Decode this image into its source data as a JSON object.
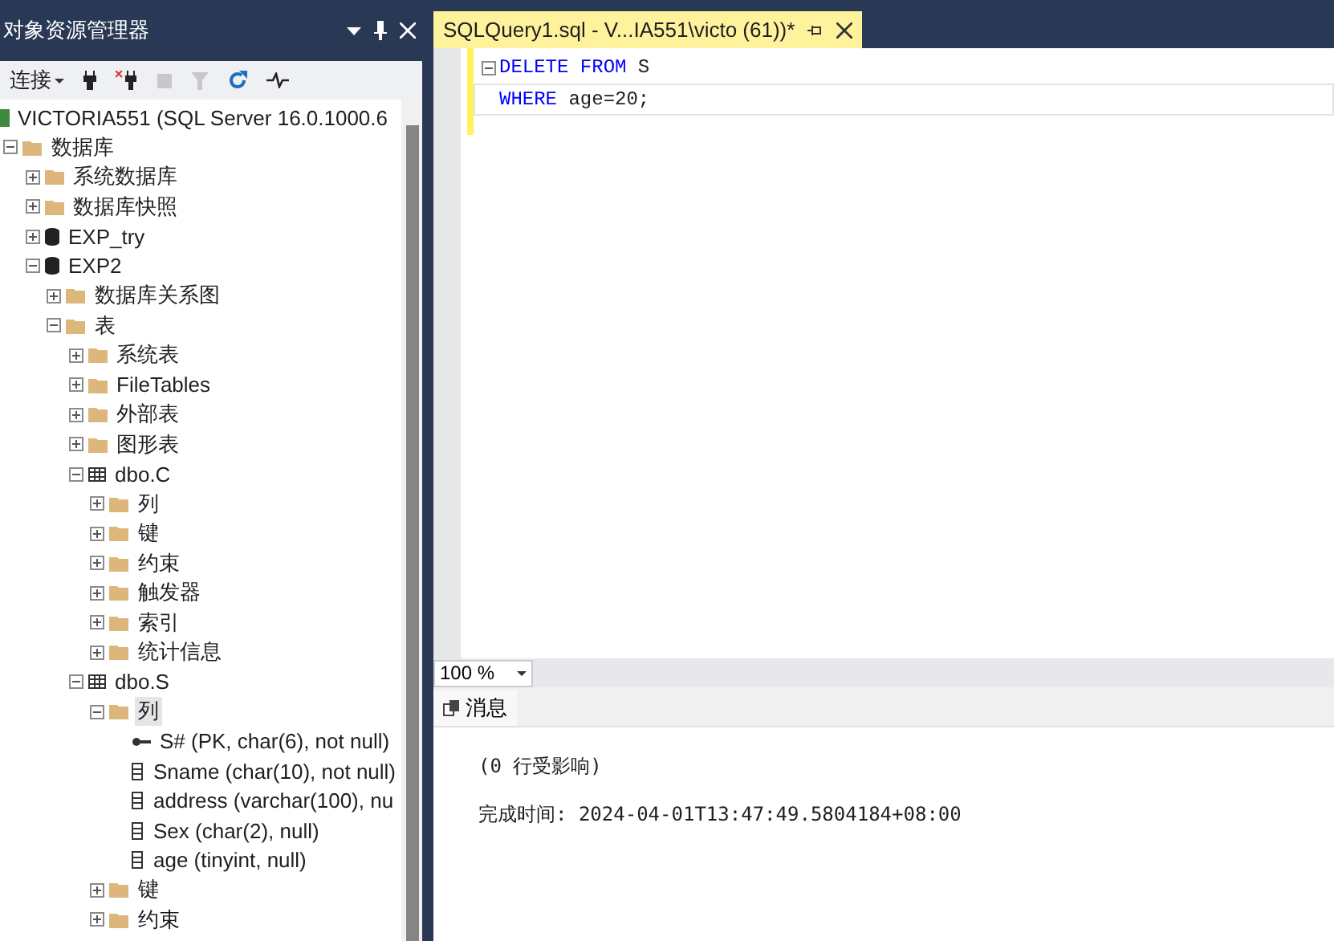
{
  "explorer": {
    "title": "对象资源管理器",
    "connect_label": "连接",
    "tree": [
      {
        "label": "VICTORIA551 (SQL Server 16.0.1000.6",
        "kind": "server",
        "children": [
          {
            "label": "数据库",
            "kind": "folder",
            "expanded": true,
            "children": [
              {
                "label": "系统数据库",
                "kind": "folder",
                "expanded": false
              },
              {
                "label": "数据库快照",
                "kind": "folder",
                "expanded": false
              },
              {
                "label": "EXP_try",
                "kind": "database",
                "expanded": false
              },
              {
                "label": "EXP2",
                "kind": "database",
                "expanded": true,
                "children": [
                  {
                    "label": "数据库关系图",
                    "kind": "folder",
                    "expanded": false
                  },
                  {
                    "label": "表",
                    "kind": "folder",
                    "expanded": true,
                    "children": [
                      {
                        "label": "系统表",
                        "kind": "folder",
                        "expanded": false
                      },
                      {
                        "label": "FileTables",
                        "kind": "folder",
                        "expanded": false
                      },
                      {
                        "label": "外部表",
                        "kind": "folder",
                        "expanded": false
                      },
                      {
                        "label": "图形表",
                        "kind": "folder",
                        "expanded": false
                      },
                      {
                        "label": "dbo.C",
                        "kind": "table",
                        "expanded": true,
                        "children": [
                          {
                            "label": "列",
                            "kind": "folder",
                            "expanded": false
                          },
                          {
                            "label": "键",
                            "kind": "folder",
                            "expanded": false
                          },
                          {
                            "label": "约束",
                            "kind": "folder",
                            "expanded": false
                          },
                          {
                            "label": "触发器",
                            "kind": "folder",
                            "expanded": false
                          },
                          {
                            "label": "索引",
                            "kind": "folder",
                            "expanded": false
                          },
                          {
                            "label": "统计信息",
                            "kind": "folder",
                            "expanded": false
                          }
                        ]
                      },
                      {
                        "label": "dbo.S",
                        "kind": "table",
                        "expanded": true,
                        "children": [
                          {
                            "label": "列",
                            "kind": "folder",
                            "expanded": true,
                            "selected": true,
                            "children": [
                              {
                                "label": "S# (PK, char(6), not null)",
                                "kind": "key"
                              },
                              {
                                "label": "Sname (char(10), not null)",
                                "kind": "column"
                              },
                              {
                                "label": "address (varchar(100), nu",
                                "kind": "column"
                              },
                              {
                                "label": "Sex (char(2), null)",
                                "kind": "column"
                              },
                              {
                                "label": "age (tinyint, null)",
                                "kind": "column"
                              }
                            ]
                          },
                          {
                            "label": "键",
                            "kind": "folder",
                            "expanded": false
                          },
                          {
                            "label": "约束",
                            "kind": "folder",
                            "expanded": false
                          }
                        ]
                      }
                    ]
                  }
                ]
              }
            ]
          }
        ]
      }
    ]
  },
  "editor_tab": {
    "title": "SQLQuery1.sql - V...IA551\\victo (61))*",
    "selected": true
  },
  "code_lines": [
    [
      {
        "text": "DELETE",
        "kind": "keyword"
      },
      {
        "text": " FROM",
        "kind": "keyword"
      },
      {
        "text": " S",
        "kind": "plain"
      }
    ],
    [
      {
        "text": "WHERE",
        "kind": "keyword"
      },
      {
        "text": " age=20;",
        "kind": "plain"
      }
    ]
  ],
  "zoom": "100 %",
  "results_tab": {
    "label": "消息",
    "selected": true
  },
  "messages": [
    "(0 行受影响)",
    "完成时间: 2024-04-01T13:47:49.5804184+08:00"
  ]
}
